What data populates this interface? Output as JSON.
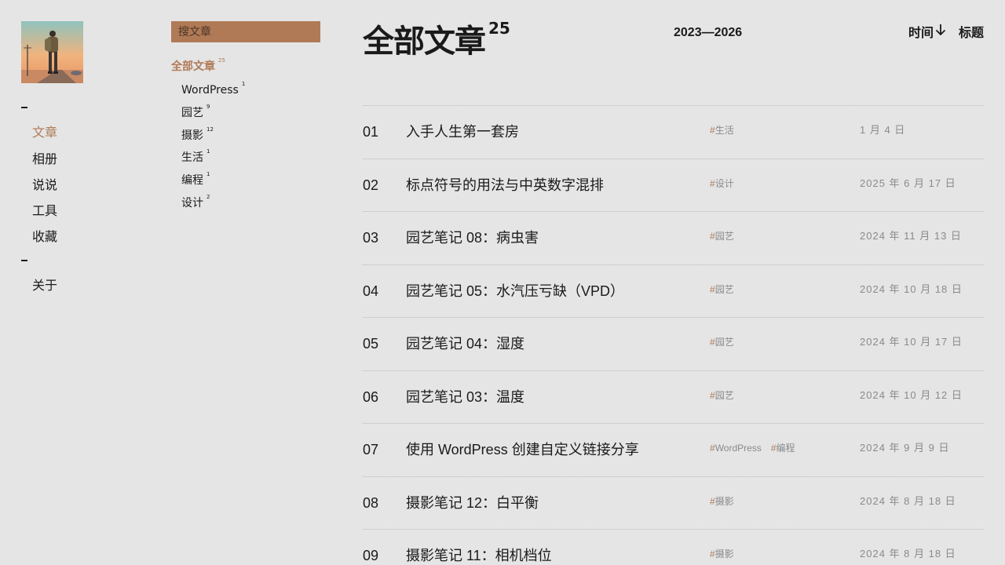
{
  "nav": {
    "items_group1": [
      {
        "label": "文章",
        "active": true
      },
      {
        "label": "相册",
        "active": false
      },
      {
        "label": "说说",
        "active": false
      },
      {
        "label": "工具",
        "active": false
      },
      {
        "label": "收藏",
        "active": false
      }
    ],
    "items_group2": [
      {
        "label": "关于",
        "active": false
      }
    ]
  },
  "search": {
    "placeholder": "搜文章"
  },
  "categories": {
    "all": {
      "label": "全部文章",
      "count": "25"
    },
    "items": [
      {
        "label": "WordPress",
        "count": "1"
      },
      {
        "label": "园艺",
        "count": "9"
      },
      {
        "label": "摄影",
        "count": "12"
      },
      {
        "label": "生活",
        "count": "1"
      },
      {
        "label": "编程",
        "count": "1"
      },
      {
        "label": "设计",
        "count": "2"
      }
    ]
  },
  "header": {
    "title": "全部文章",
    "count": "25",
    "range": "2023—2026",
    "sort_time": "时间",
    "sort_title": "标题"
  },
  "articles": [
    {
      "num": "01",
      "title": "入手人生第一套房",
      "tags": [
        "生活"
      ],
      "date": "1 月 4 日"
    },
    {
      "num": "02",
      "title": "标点符号的用法与中英数字混排",
      "tags": [
        "设计"
      ],
      "date": "2025 年 6 月 17 日"
    },
    {
      "num": "03",
      "title": "园艺笔记 08：病虫害",
      "tags": [
        "园艺"
      ],
      "date": "2024 年 11 月 13 日"
    },
    {
      "num": "04",
      "title": "园艺笔记 05：水汽压亏缺（VPD）",
      "tags": [
        "园艺"
      ],
      "date": "2024 年 10 月 18 日"
    },
    {
      "num": "05",
      "title": "园艺笔记 04：湿度",
      "tags": [
        "园艺"
      ],
      "date": "2024 年 10 月 17 日"
    },
    {
      "num": "06",
      "title": "园艺笔记 03：温度",
      "tags": [
        "园艺"
      ],
      "date": "2024 年 10 月 12 日"
    },
    {
      "num": "07",
      "title": "使用 WordPress 创建自定义链接分享",
      "tags": [
        "WordPress",
        "编程"
      ],
      "date": "2024 年 9 月 9 日"
    },
    {
      "num": "08",
      "title": "摄影笔记 12：白平衡",
      "tags": [
        "摄影"
      ],
      "date": "2024 年 8 月 18 日"
    },
    {
      "num": "09",
      "title": "摄影笔记 11：相机档位",
      "tags": [
        "摄影"
      ],
      "date": "2024 年 8 月 18 日"
    }
  ],
  "colors": {
    "background": "#e5e5e5",
    "accent": "#b07a57",
    "text": "#1a1a1a",
    "muted": "#8a8a8a"
  },
  "icons": {
    "sort": "arrow-down-icon",
    "avatar": "hiker-illustration"
  }
}
